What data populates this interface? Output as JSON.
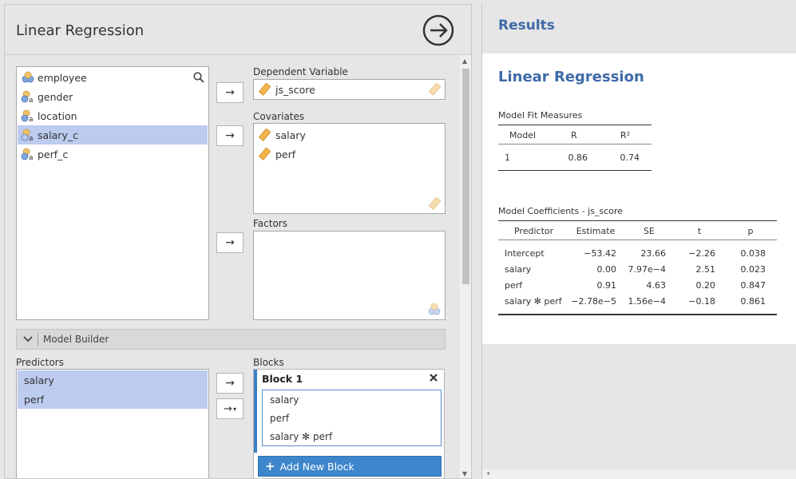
{
  "dialog": {
    "title": "Linear Regression"
  },
  "variables": [
    {
      "name": "employee",
      "icon": "nominal-multi-icon"
    },
    {
      "name": "gender",
      "icon": "nominal-text-icon"
    },
    {
      "name": "location",
      "icon": "nominal-text-icon"
    },
    {
      "name": "salary_c",
      "icon": "nominal-text-icon",
      "selected": true
    },
    {
      "name": "perf_c",
      "icon": "nominal-text-icon"
    }
  ],
  "dependent": {
    "label": "Dependent Variable",
    "value": "js_score"
  },
  "covariates": {
    "label": "Covariates",
    "items": [
      "salary",
      "perf"
    ]
  },
  "factors": {
    "label": "Factors",
    "items": []
  },
  "model_builder": {
    "title": "Model Builder",
    "predictors_label": "Predictors",
    "predictors": [
      "salary",
      "perf"
    ],
    "blocks_label": "Blocks",
    "block_title": "Block 1",
    "block_terms": [
      "salary",
      "perf",
      "salary ✻ perf"
    ],
    "add_block_label": "Add New Block"
  },
  "results": {
    "header": "Results",
    "analysis_title": "Linear Regression",
    "fit_caption": "Model Fit Measures",
    "fit_headers": [
      "Model",
      "R",
      "R²"
    ],
    "fit_row": [
      "1",
      "0.86",
      "0.74"
    ],
    "coef_caption": "Model Coefficients - js_score",
    "coef_headers": [
      "Predictor",
      "Estimate",
      "SE",
      "t",
      "p"
    ],
    "coef_rows": [
      [
        "Intercept",
        "−53.42",
        "23.66",
        "−2.26",
        "0.038"
      ],
      [
        "salary",
        "0.00",
        "7.97e−4",
        "2.51",
        "0.023"
      ],
      [
        "perf",
        "0.91",
        "4.63",
        "0.20",
        "0.847"
      ],
      [
        "salary ✻ perf",
        "−2.78e−5",
        "1.56e−4",
        "−0.18",
        "0.861"
      ]
    ]
  },
  "colors": {
    "accent": "#3e6aa8",
    "selection": "#bccbee",
    "button": "#3d86cb"
  }
}
